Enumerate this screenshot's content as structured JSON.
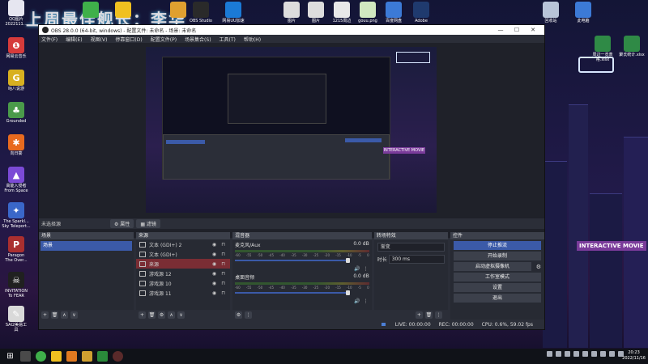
{
  "overlay": {
    "title": "上周最佳舰长：李华"
  },
  "desktop": {
    "icons_left": [
      {
        "label": "QQ图片\n2022111...",
        "icon": "qq-image-icon",
        "color": "#e6e6f0"
      },
      {
        "label": "网易云音乐",
        "icon": "netease-music-icon",
        "color": "#d63b3b",
        "glyph": "❶"
      },
      {
        "label": "咕八说游",
        "icon": "game-app-icon",
        "color": "#d8b020",
        "glyph": "G"
      },
      {
        "label": "Grounded",
        "icon": "grounded-game-icon",
        "color": "#4a9a4a",
        "glyph": "♣"
      },
      {
        "label": "向日葵",
        "icon": "sunflower-remote-icon",
        "color": "#e86a1f",
        "glyph": "✱"
      },
      {
        "label": "高能入侵者\nFrom Space",
        "icon": "space-game-icon",
        "color": "#7b4ad6",
        "glyph": "▲"
      },
      {
        "label": "The Sparkl...\nSky Teleport...",
        "icon": "sparkle-game-icon",
        "color": "#3a67c9",
        "glyph": "✦"
      },
      {
        "label": "Paragon\nThe Over...",
        "icon": "paragon-game-icon",
        "color": "#aa2f2f",
        "glyph": "P"
      },
      {
        "label": "INVITATION\nTo FEAR",
        "icon": "horror-game-icon",
        "color": "#202020",
        "glyph": "☠"
      },
      {
        "label": "SAI2美易工\n具",
        "icon": "sai2-paint-icon",
        "color": "#d9d9d9",
        "glyph": "✎"
      }
    ],
    "icons_top": [
      {
        "label": "",
        "icon": "wechat-icon",
        "color": "#3fb04a"
      },
      {
        "label": "",
        "icon": "meituan-icon",
        "color": "#f0c020"
      },
      {
        "label": "",
        "icon": "coin-icon",
        "color": "#e0a030"
      },
      {
        "label": "OBS Studio",
        "icon": "obs-desktop-icon",
        "color": "#2a2a2a"
      },
      {
        "label": "网易UU加速",
        "icon": "uu-accelerator-icon",
        "color": "#1b7ad6"
      },
      {
        "label": "图片",
        "icon": "image-file-icon",
        "color": "#dddddd"
      },
      {
        "label": "图片",
        "icon": "image-file-icon-2",
        "color": "#dddddd"
      },
      {
        "label": "1215周边",
        "icon": "folder-doc-icon",
        "color": "#e8e8e8"
      },
      {
        "label": "gouu.png",
        "icon": "png-file-icon",
        "color": "#d0e8c0"
      },
      {
        "label": "百度网盘",
        "icon": "baidu-netdisk-icon",
        "color": "#3c7ad6"
      },
      {
        "label": "Adobe",
        "icon": "photoshop-icon",
        "color": "#1f3a6e"
      }
    ],
    "icons_right": [
      {
        "label": "回收站",
        "icon": "recycle-bin-icon",
        "color": "#b8c4d8"
      },
      {
        "label": "此电脑",
        "icon": "this-pc-icon",
        "color": "#3c7ad6"
      },
      {
        "label": "周边一览表\n格.xlsx",
        "icon": "excel-file-icon",
        "color": "#2f8a46"
      },
      {
        "label": "聚氏统计.xlsx",
        "icon": "excel-file-icon-2",
        "color": "#2f8a46"
      }
    ],
    "neon_sign": "INTERACTIVE MOVIE"
  },
  "obs": {
    "title": "OBS 28.0.0 (64-bit, windows) - 配置文件: 未命名 - 场景: 未命名",
    "menu": [
      "文件(F)",
      "编辑(E)",
      "视图(V)",
      "停靠窗口(D)",
      "配置文件(P)",
      "场景集合(S)",
      "工具(T)",
      "帮助(H)"
    ],
    "source_bar": {
      "label": "未选择源",
      "properties": "属性",
      "filters": "滤镜"
    },
    "docks": {
      "scenes": {
        "title": "场景",
        "items": [
          "场景"
        ]
      },
      "sources": {
        "title": "来源",
        "items": [
          {
            "name": "文本 (GDI+) 2",
            "selected": false
          },
          {
            "name": "文本 (GDI+)",
            "selected": false
          },
          {
            "name": "来源",
            "selected": true
          },
          {
            "name": "游戏源 12",
            "selected": false
          },
          {
            "name": "游戏源 10",
            "selected": false
          },
          {
            "name": "游戏源 11",
            "selected": false
          }
        ]
      },
      "mixer": {
        "title": "混音器",
        "channels": [
          {
            "name": "麦克风/Aux",
            "db": "0.0 dB"
          },
          {
            "name": "桌面音频",
            "db": "0.0 dB"
          }
        ],
        "scale": [
          "-60",
          "-55",
          "-50",
          "-45",
          "-40",
          "-35",
          "-30",
          "-25",
          "-20",
          "-15",
          "-10",
          "-5",
          "0"
        ]
      },
      "transitions": {
        "title": "转场特效",
        "type": "渐变",
        "duration_label": "时长",
        "duration": "300 ms"
      },
      "controls": {
        "title": "控件",
        "buttons": [
          {
            "label": "停止推流",
            "primary": true
          },
          {
            "label": "开始录制",
            "primary": false
          },
          {
            "label": "启动虚拟摄像机",
            "primary": false
          },
          {
            "label": "工作室模式",
            "primary": false
          },
          {
            "label": "设置",
            "primary": false
          },
          {
            "label": "退出",
            "primary": false
          }
        ]
      }
    },
    "status": {
      "live": "LIVE: 00:00:00",
      "rec": "REC: 00:00:00",
      "cpu": "CPU: 0.6%, 59.02 fps"
    }
  },
  "taskbar": {
    "time": "20:23",
    "date": "2022/11/16"
  }
}
